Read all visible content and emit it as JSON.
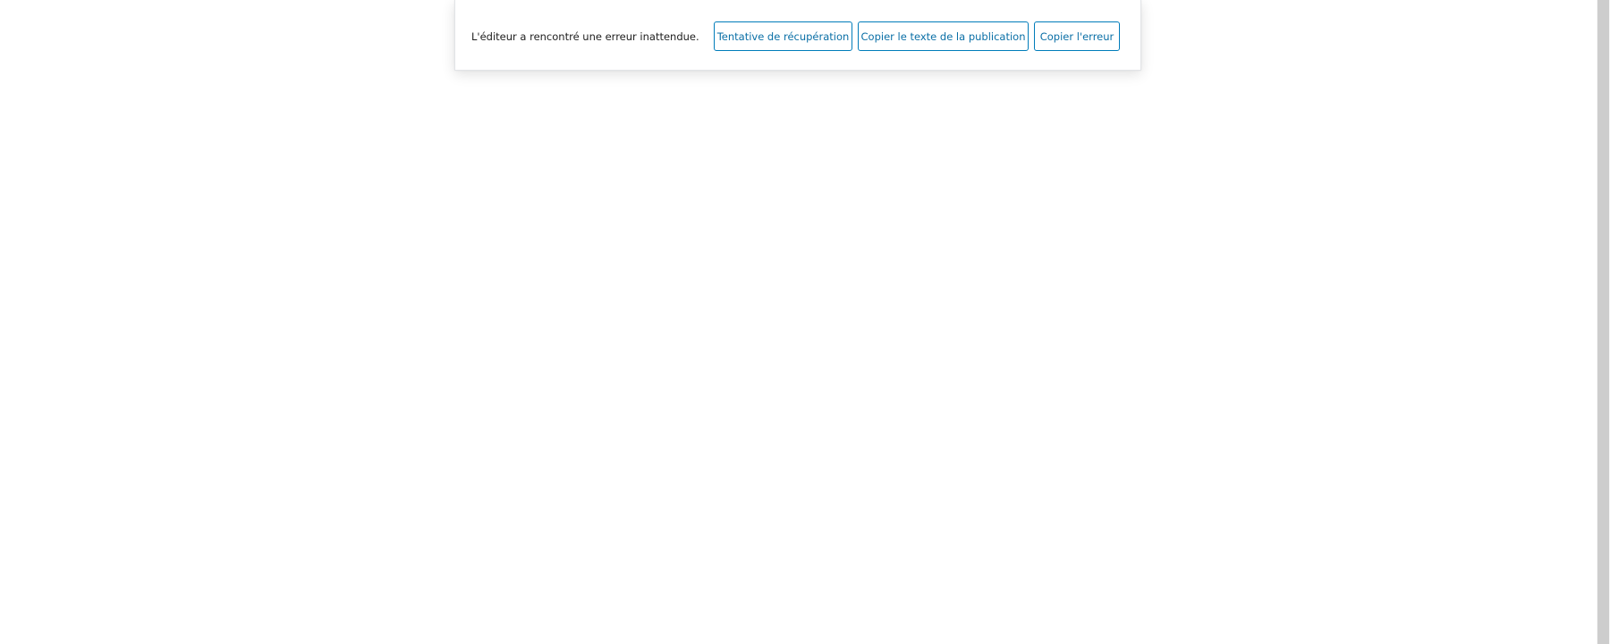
{
  "notice": {
    "message": "L'éditeur a rencontré une erreur inattendue.",
    "actions": {
      "recover_label": "Tentative de récupération",
      "copy_text_label": "Copier le texte de la publication",
      "copy_error_label": "Copier l'erreur"
    }
  },
  "colors": {
    "button_border": "#007cba",
    "button_text": "#0a6fa6",
    "message_text": "#1e1e1e",
    "background": "#ffffff"
  }
}
